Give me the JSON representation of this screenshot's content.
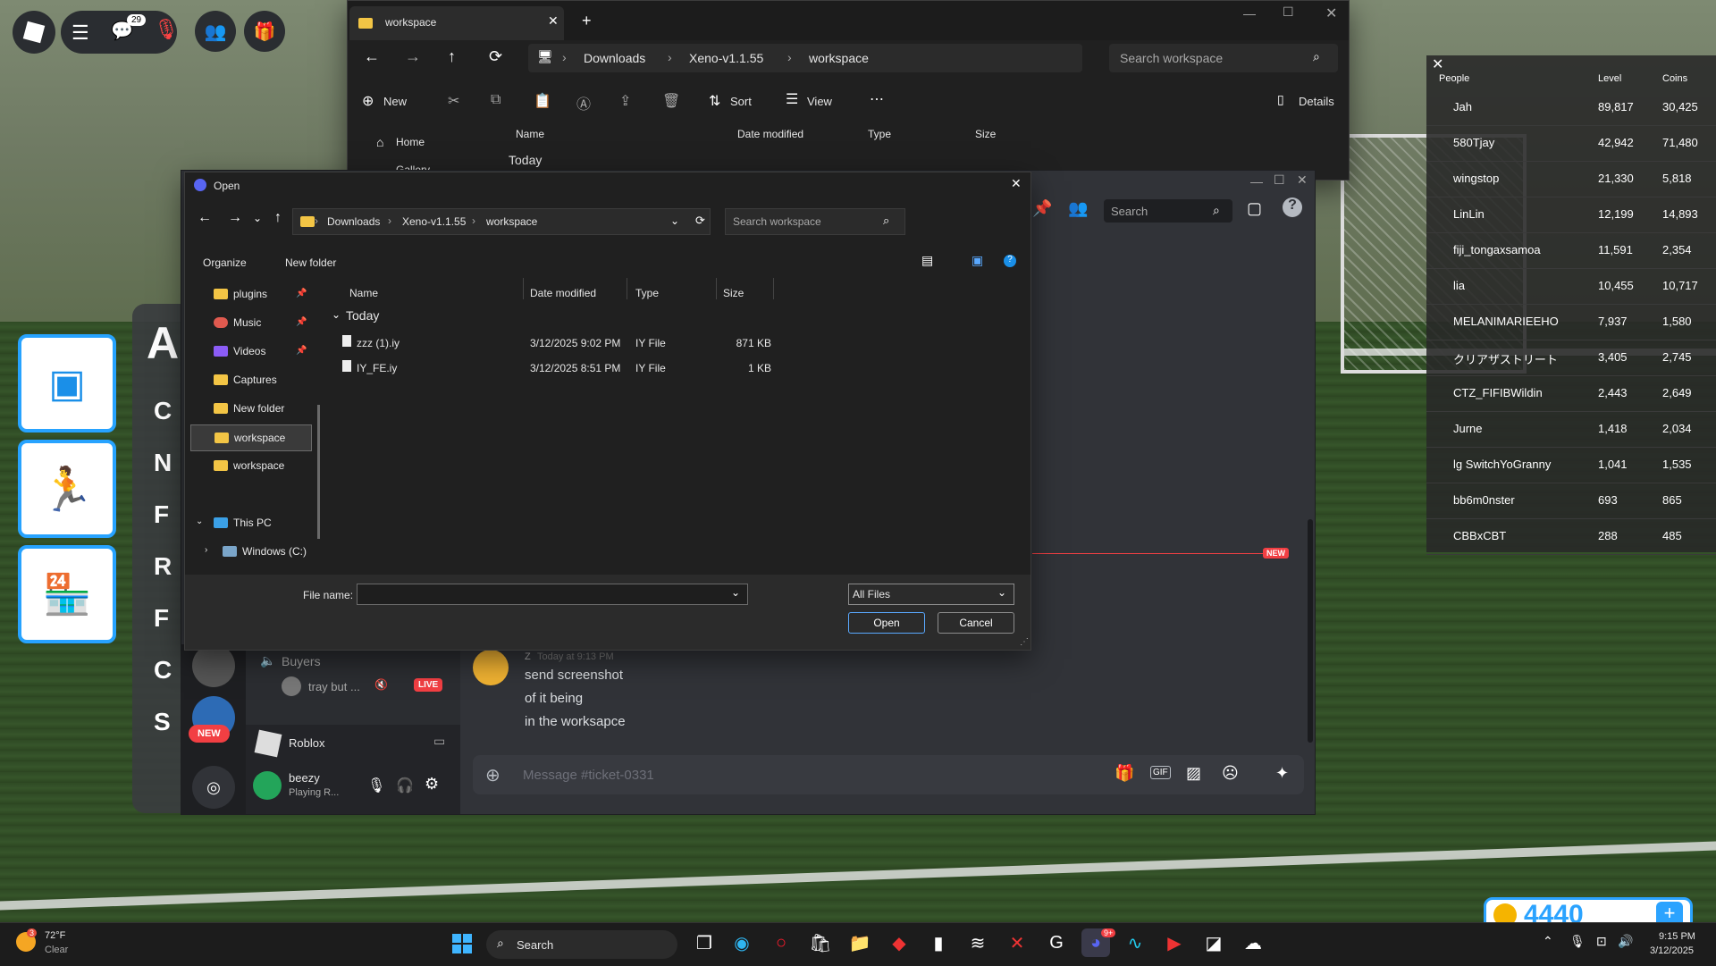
{
  "roblox": {
    "chat_badge": "29",
    "side_letter": "A",
    "menu_letters": [
      "C",
      "N",
      "F",
      "R",
      "F",
      "C",
      "S"
    ]
  },
  "explorer": {
    "tab_title": "workspace",
    "breadcrumb": [
      "Downloads",
      "Xeno-v1.1.55",
      "workspace"
    ],
    "search_placeholder": "Search workspace",
    "toolbar": {
      "new": "New",
      "sort": "Sort",
      "view": "View",
      "details": "Details"
    },
    "nav": [
      "Home",
      "Gallery"
    ],
    "columns": [
      "Name",
      "Date modified",
      "Type",
      "Size"
    ],
    "group": "Today"
  },
  "dialog": {
    "title": "Open",
    "breadcrumb": [
      "Downloads",
      "Xeno-v1.1.55",
      "workspace"
    ],
    "search_placeholder": "Search workspace",
    "organize": "Organize",
    "new_folder": "New folder",
    "sidebar": [
      "plugins",
      "Music",
      "Videos",
      "Captures",
      "New folder",
      "workspace",
      "workspace",
      "This PC",
      "Windows (C:)"
    ],
    "columns": [
      "Name",
      "Date modified",
      "Type",
      "Size"
    ],
    "group": "Today",
    "files": [
      {
        "name": "zzz (1).iy",
        "date": "3/12/2025 9:02 PM",
        "type": "IY File",
        "size": "871 KB"
      },
      {
        "name": "IY_FE.iy",
        "date": "3/12/2025 8:51 PM",
        "type": "IY File",
        "size": "1 KB"
      }
    ],
    "file_name_label": "File name:",
    "file_name_value": "",
    "filter": "All Files",
    "open": "Open",
    "cancel": "Cancel"
  },
  "discord": {
    "search_placeholder": "Search",
    "new_badge": "NEW",
    "channel_buyers": "Buyers",
    "live_user": "tray but ...",
    "live_badge": "LIVE",
    "server_new": "NEW",
    "game_label": "Roblox",
    "user_name": "beezy",
    "user_status": "Playing R...",
    "message_author": "Z",
    "message_time": "Today at 9:13 PM",
    "messages": [
      "send screenshot",
      "of it being",
      "in the worksapce"
    ],
    "input_placeholder": "Message #ticket-0331"
  },
  "leaderboard": {
    "headers": [
      "People",
      "Level",
      "Coins"
    ],
    "rows": [
      {
        "name": "Jah",
        "level": "89,817",
        "coins": "30,425"
      },
      {
        "name": "580Tjay",
        "level": "42,942",
        "coins": "71,480"
      },
      {
        "name": "wingstop",
        "level": "21,330",
        "coins": "5,818"
      },
      {
        "name": "LinLin",
        "level": "12,199",
        "coins": "14,893"
      },
      {
        "name": "fiji_tongaxsamoa",
        "level": "11,591",
        "coins": "2,354"
      },
      {
        "name": "lia",
        "level": "10,455",
        "coins": "10,717"
      },
      {
        "name": "MELANIMARIEEHO",
        "level": "7,937",
        "coins": "1,580"
      },
      {
        "name": "クリアザストリート",
        "level": "3,405",
        "coins": "2,745"
      },
      {
        "name": "CTZ_FIFIBWildin",
        "level": "2,443",
        "coins": "2,649"
      },
      {
        "name": "Jurne",
        "level": "1,418",
        "coins": "2,034"
      },
      {
        "name": "lg SwitchYoGranny",
        "level": "1,041",
        "coins": "1,535"
      },
      {
        "name": "bb6m0nster",
        "level": "693",
        "coins": "865"
      },
      {
        "name": "CBBxCBT",
        "level": "288",
        "coins": "485"
      }
    ]
  },
  "coins_display": "4440",
  "taskbar": {
    "temp": "72°F",
    "condition": "Clear",
    "weather_badge": "3",
    "search": "Search",
    "discord_badge": "9+",
    "time": "9:15 PM",
    "date": "3/12/2025"
  }
}
